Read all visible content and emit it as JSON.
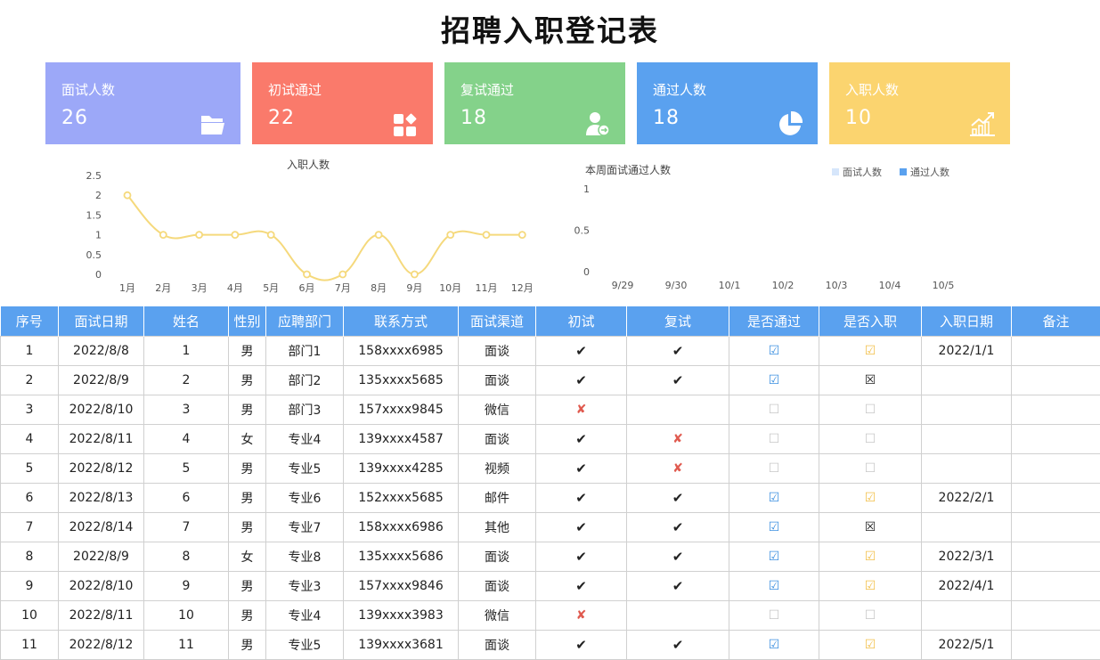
{
  "title": "招聘入职登记表",
  "cards": [
    {
      "label": "面试人数",
      "value": "26",
      "color": "#9ca8f8",
      "icon": "folder-icon"
    },
    {
      "label": "初试通过",
      "value": "22",
      "color": "#fa7a6b",
      "icon": "apps-icon"
    },
    {
      "label": "复试通过",
      "value": "18",
      "color": "#84d28a",
      "icon": "user-check-icon"
    },
    {
      "label": "通过人数",
      "value": "18",
      "color": "#5aa1ef",
      "icon": "pie-icon"
    },
    {
      "label": "入职人数",
      "value": "10",
      "color": "#fbd46f",
      "icon": "growth-chart-icon"
    }
  ],
  "chart_data": [
    {
      "type": "line",
      "title": "入职人数",
      "categories": [
        "1月",
        "2月",
        "3月",
        "4月",
        "5月",
        "6月",
        "7月",
        "8月",
        "9月",
        "10月",
        "11月",
        "12月"
      ],
      "series": [
        {
          "values": [
            2,
            1,
            1,
            1,
            1,
            0,
            0,
            1,
            0,
            1,
            1,
            1
          ],
          "color": "#f5d97c"
        }
      ],
      "yticks": [
        "0",
        "0.5",
        "1",
        "1.5",
        "2",
        "2.5"
      ],
      "ylim": [
        0,
        2.5
      ],
      "smooth": true
    },
    {
      "type": "bar",
      "title": "本周面试通过人数",
      "categories": [
        "9/29",
        "9/30",
        "10/1",
        "10/2",
        "10/3",
        "10/4",
        "10/5"
      ],
      "series": [
        {
          "name": "面试人数",
          "values": [
            0,
            0,
            0,
            0,
            0,
            0,
            0
          ],
          "color": "#d6e6fb"
        },
        {
          "name": "通过人数",
          "values": [
            0,
            0,
            0,
            0,
            0,
            0,
            0
          ],
          "color": "#5aa1ef"
        }
      ],
      "yticks": [
        "0",
        "0.5",
        "1"
      ],
      "ylim": [
        0,
        1
      ],
      "legend": "top-right"
    }
  ],
  "table": {
    "headers": [
      "序号",
      "面试日期",
      "姓名",
      "性别",
      "应聘部门",
      "联系方式",
      "面试渠道",
      "初试",
      "复试",
      "是否通过",
      "是否入职",
      "入职日期",
      "备注"
    ],
    "rows": [
      [
        "1",
        "2022/8/8",
        "1",
        "男",
        "部门1",
        "158xxxx6985",
        "面谈",
        "✔",
        "✔",
        "☑",
        "☑",
        "2022/1/1",
        ""
      ],
      [
        "2",
        "2022/8/9",
        "2",
        "男",
        "部门2",
        "135xxxx5685",
        "面谈",
        "✔",
        "✔",
        "☑",
        "☒",
        "",
        ""
      ],
      [
        "3",
        "2022/8/10",
        "3",
        "男",
        "部门3",
        "157xxxx9845",
        "微信",
        "✘",
        "",
        "☐",
        "☐",
        "",
        ""
      ],
      [
        "4",
        "2022/8/11",
        "4",
        "女",
        "专业4",
        "139xxxx4587",
        "面谈",
        "✔",
        "✘",
        "☐",
        "☐",
        "",
        ""
      ],
      [
        "5",
        "2022/8/12",
        "5",
        "男",
        "专业5",
        "139xxxx4285",
        "视频",
        "✔",
        "✘",
        "☐",
        "☐",
        "",
        ""
      ],
      [
        "6",
        "2022/8/13",
        "6",
        "男",
        "专业6",
        "152xxxx5685",
        "邮件",
        "✔",
        "✔",
        "☑",
        "☑",
        "2022/2/1",
        ""
      ],
      [
        "7",
        "2022/8/14",
        "7",
        "男",
        "专业7",
        "158xxxx6986",
        "其他",
        "✔",
        "✔",
        "☑",
        "☒",
        "",
        ""
      ],
      [
        "8",
        "2022/8/9",
        "8",
        "女",
        "专业8",
        "135xxxx5686",
        "面谈",
        "✔",
        "✔",
        "☑",
        "☑",
        "2022/3/1",
        ""
      ],
      [
        "9",
        "2022/8/10",
        "9",
        "男",
        "专业3",
        "157xxxx9846",
        "面谈",
        "✔",
        "✔",
        "☑",
        "☑",
        "2022/4/1",
        ""
      ],
      [
        "10",
        "2022/8/11",
        "10",
        "男",
        "专业4",
        "139xxxx3983",
        "微信",
        "✘",
        "",
        "☐",
        "☐",
        "",
        ""
      ],
      [
        "11",
        "2022/8/12",
        "11",
        "男",
        "专业5",
        "139xxxx3681",
        "面谈",
        "✔",
        "✔",
        "☑",
        "☑",
        "2022/5/1",
        ""
      ]
    ]
  }
}
